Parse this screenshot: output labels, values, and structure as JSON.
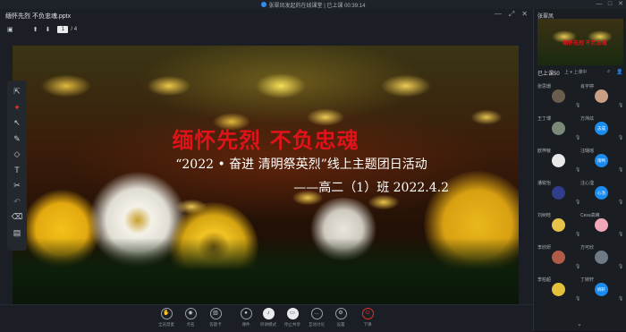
{
  "window": {
    "title": "张翠凤发起的在线课堂 | 已上课 00:39:14",
    "controls": [
      "—",
      "□",
      "✕"
    ]
  },
  "document": {
    "file_name": "缅怀先烈 不负忠魂.pptx",
    "page_current": "1",
    "page_total": "/ 4"
  },
  "slide": {
    "title": "缅怀先烈   不负忠魂",
    "subtitle": "“2022 • 奋进  清明祭英烈”线上主题团日活动",
    "byline": "——高二（1）班   2022.4.2"
  },
  "side_tools": [
    "arrow-icon",
    "laser-icon",
    "select-icon",
    "pen-icon",
    "shapes-icon",
    "text-icon",
    "scissors-icon",
    "undo-icon",
    "eraser-icon",
    "toolbox-icon"
  ],
  "bottom_toolbar": [
    {
      "label": "全员禁麦",
      "icon": "hand-icon"
    },
    {
      "label": "点名",
      "icon": "location-icon"
    },
    {
      "label": "答题卡",
      "icon": "card-icon"
    },
    {
      "label": "课件",
      "icon": "doc-icon"
    },
    {
      "label": "听讲模式",
      "icon": "listen-icon"
    },
    {
      "label": "停止共享",
      "icon": "screen-icon"
    },
    {
      "label": "互动讨论",
      "icon": "chat-icon"
    },
    {
      "label": "设置",
      "icon": "gear-icon"
    },
    {
      "label": "下课",
      "icon": "power-icon"
    }
  ],
  "right_panel": {
    "title": "张翠凤",
    "thumb_title": "缅怀先烈 不负忠魂",
    "attended": "已上课50",
    "speak_btn": "上 ▾ 上课中",
    "participants": [
      {
        "name": "张思珊",
        "avatar_text": "",
        "color": "#6a5d4d"
      },
      {
        "name": "肖宇婷",
        "avatar_text": "",
        "color": "#c9a084"
      },
      {
        "name": "王丁博",
        "avatar_text": "",
        "color": "#7b8a78"
      },
      {
        "name": "方炜炫",
        "avatar_text": "志成",
        "color": "#1a8cf0"
      },
      {
        "name": "欧梓敏",
        "avatar_text": "",
        "color": "#e8e8e8"
      },
      {
        "name": "汪璐瑶",
        "avatar_text": "雨鸭",
        "color": "#1a8cf0"
      },
      {
        "name": "潘锐怡",
        "avatar_text": "",
        "color": "#2f3d8a"
      },
      {
        "name": "汪心滢",
        "avatar_text": "心泡",
        "color": "#1a8cf0"
      },
      {
        "name": "刘树晗",
        "avatar_text": "",
        "color": "#e7c24a"
      },
      {
        "name": "Cesa高峰",
        "avatar_text": "",
        "color": "#f0a8b8"
      },
      {
        "name": "李欣妍",
        "avatar_text": "",
        "color": "#b05a48"
      },
      {
        "name": "方可欣",
        "avatar_text": "",
        "color": "#6e7a86"
      },
      {
        "name": "李柏超",
        "avatar_text": "",
        "color": "#e3c13c"
      },
      {
        "name": "丁婉轩",
        "avatar_text": "婉轩",
        "color": "#1a8cf0"
      }
    ]
  }
}
